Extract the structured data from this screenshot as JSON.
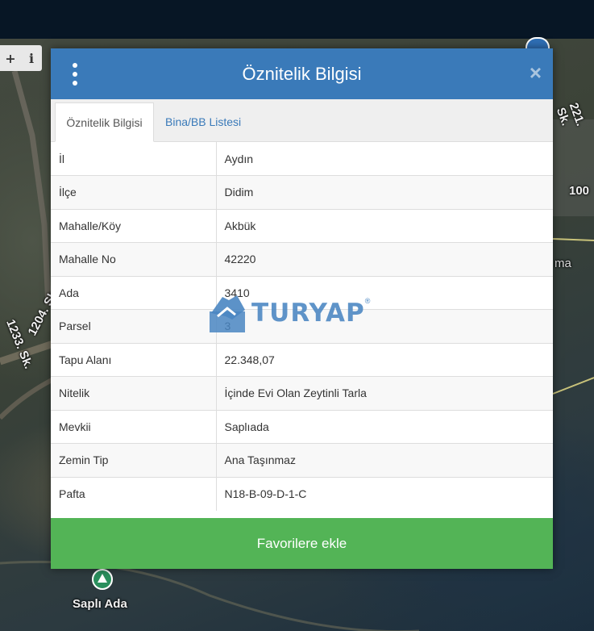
{
  "map": {
    "labels": [
      "1204. Sk.",
      "1233. Sk.",
      "Saplı Ada",
      "221. Sk.",
      "100",
      "ma"
    ],
    "controls": [
      "+",
      "i"
    ]
  },
  "modal": {
    "title": "Öznitelik Bilgisi",
    "close_symbol": "×",
    "tabs": [
      {
        "label": "Öznitelik Bilgisi",
        "active": true
      },
      {
        "label": "Bina/BB Listesi",
        "active": false
      }
    ],
    "rows": [
      {
        "key": "İl",
        "value": "Aydın"
      },
      {
        "key": "İlçe",
        "value": "Didim"
      },
      {
        "key": "Mahalle/Köy",
        "value": "Akbük"
      },
      {
        "key": "Mahalle No",
        "value": "42220"
      },
      {
        "key": "Ada",
        "value": "3410"
      },
      {
        "key": "Parsel",
        "value": "3"
      },
      {
        "key": "Tapu Alanı",
        "value": "22.348,07"
      },
      {
        "key": "Nitelik",
        "value": "İçinde Evi Olan Zeytinli Tarla"
      },
      {
        "key": "Mevkii",
        "value": "Saplıada"
      },
      {
        "key": "Zemin Tip",
        "value": "Ana Taşınmaz"
      },
      {
        "key": "Pafta",
        "value": "N18-B-09-D-1-C"
      }
    ],
    "favorite_button": "Favorilere ekle"
  },
  "watermark": {
    "text": "TURYAP",
    "registered": "®"
  },
  "colors": {
    "header": "#3a7ab9",
    "favorite": "#53b456",
    "topbar": "#071625",
    "watermark": "#4a86c2"
  }
}
